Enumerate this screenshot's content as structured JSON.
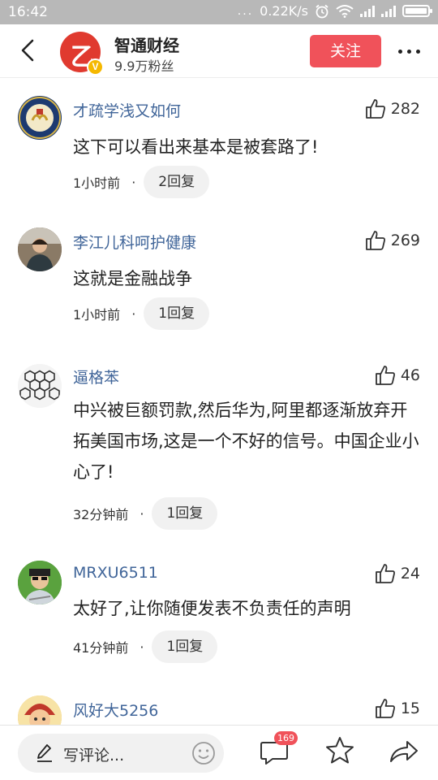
{
  "status_bar": {
    "time": "16:42",
    "dots": "...",
    "net_speed": "0.22K/s",
    "alarm_icon": "alarm-clock-icon",
    "wifi_icon": "wifi-icon",
    "signal_icon": "cell-signal-icon",
    "battery_icon": "battery-icon"
  },
  "header": {
    "back_icon": "back-chevron-icon",
    "account_name": "智通财经",
    "followers": "9.9万粉丝",
    "verified_badge": "V",
    "follow_label": "关注",
    "more_icon": "more-dots-icon",
    "accent_color": "#f0525a"
  },
  "comments": [
    {
      "user": "才疏学浅又如何",
      "likes": "282",
      "text": "这下可以看出来基本是被套路了!",
      "time": "1小时前",
      "dot": "·",
      "replies": "2回复"
    },
    {
      "user": "李江儿科呵护健康",
      "likes": "269",
      "text": "这就是金融战争",
      "time": "1小时前",
      "dot": "·",
      "replies": "1回复"
    },
    {
      "user": "逼格苯",
      "likes": "46",
      "text": "中兴被巨额罚款,然后华为,阿里都逐渐放弃开拓美国市场,这是一个不好的信号。中国企业小心了!",
      "time": "32分钟前",
      "dot": "·",
      "replies": "1回复"
    },
    {
      "user": "MRXU6511",
      "likes": "24",
      "text": "太好了,让你随便发表不负责任的声明",
      "time": "41分钟前",
      "dot": "·",
      "replies": "1回复"
    },
    {
      "user": "风好大5256",
      "likes": "15"
    }
  ],
  "bottom_bar": {
    "input_placeholder": "写评论...",
    "comment_count": "169",
    "icons": [
      "pen-icon",
      "smile-icon",
      "comment-bubble-icon",
      "star-icon",
      "share-icon"
    ]
  }
}
